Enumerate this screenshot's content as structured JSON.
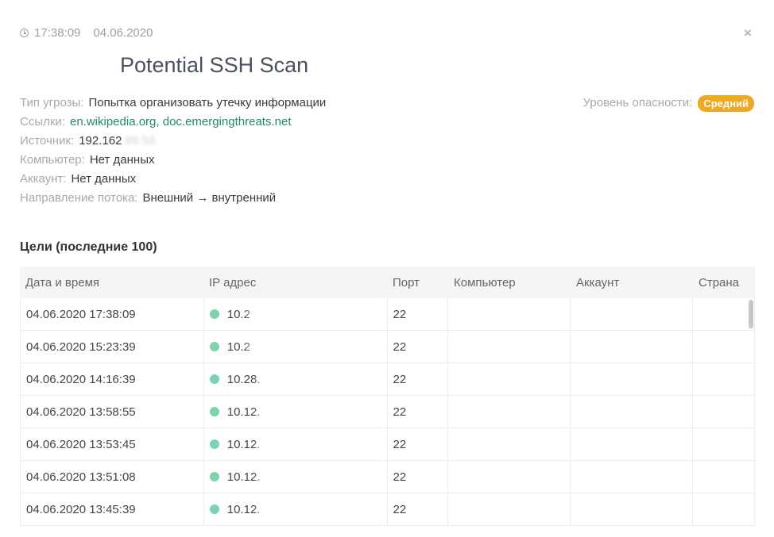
{
  "header": {
    "time": "17:38:09",
    "date": "04.06.2020",
    "close_icon": "×",
    "title": "Potential SSH Scan"
  },
  "info": {
    "threat_type_label": "Тип угрозы:",
    "threat_type_value": "Попытка организовать утечку информации",
    "links_label": "Ссылки:",
    "link1": "en.wikipedia.org",
    "link_sep": ", ",
    "link2": "doc.emergingthreats.net",
    "source_label": "Источник:",
    "source_value": "192.162",
    "source_hidden": ".89.53",
    "computer_label": "Компьютер:",
    "computer_value": "Нет данных",
    "account_label": "Аккаунт:",
    "account_value": "Нет данных",
    "flow_label": "Направление потока:",
    "flow_value": "Внешний → внутренний"
  },
  "severity": {
    "label": "Уровень опасности:",
    "value": "Средний",
    "color": "#f0a722"
  },
  "targets": {
    "title": "Цели (последние 100)",
    "columns": [
      "Дата и время",
      "IP адрес",
      "Порт",
      "Компьютер",
      "Аккаунт",
      "Страна"
    ],
    "rows": [
      {
        "datetime": "04.06.2020 17:38:09",
        "ip": "10.2",
        "port": "22",
        "computer": "",
        "account": "",
        "country": ""
      },
      {
        "datetime": "04.06.2020 15:23:39",
        "ip": "10.2",
        "port": "22",
        "computer": "",
        "account": "",
        "country": ""
      },
      {
        "datetime": "04.06.2020 14:16:39",
        "ip": "10.28.",
        "port": "22",
        "computer": "",
        "account": "",
        "country": ""
      },
      {
        "datetime": "04.06.2020 13:58:55",
        "ip": "10.12.",
        "port": "22",
        "computer": "",
        "account": "",
        "country": ""
      },
      {
        "datetime": "04.06.2020 13:53:45",
        "ip": "10.12.",
        "port": "22",
        "computer": "",
        "account": "",
        "country": ""
      },
      {
        "datetime": "04.06.2020 13:51:08",
        "ip": "10.12.",
        "port": "22",
        "computer": "",
        "account": "",
        "country": ""
      },
      {
        "datetime": "04.06.2020 13:45:39",
        "ip": "10.12.",
        "port": "22",
        "computer": "",
        "account": "",
        "country": ""
      }
    ],
    "status_color": "#7dd3ac"
  }
}
